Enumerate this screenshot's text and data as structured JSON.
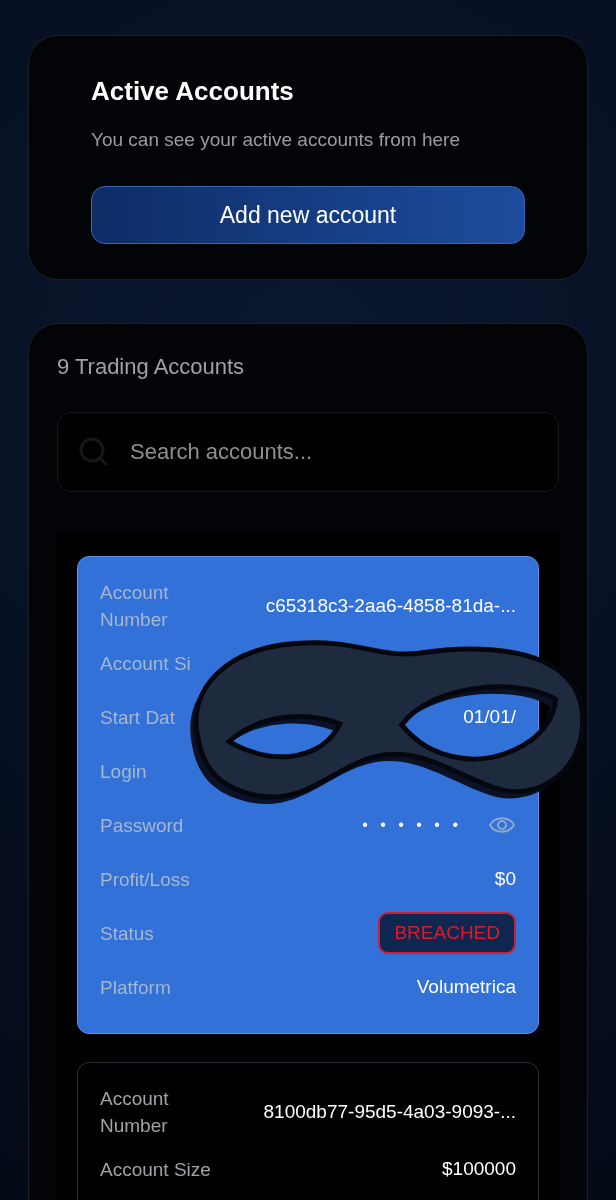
{
  "active_panel": {
    "title": "Active Accounts",
    "subtitle": "You can see your active accounts from here",
    "button": "Add new account"
  },
  "accounts_panel": {
    "count_label": "9 Trading Accounts",
    "search": {
      "placeholder": "Search accounts..."
    },
    "accounts": [
      {
        "selected": true,
        "masked": true,
        "rows": [
          {
            "kind": "text",
            "label": "Account Number",
            "value": "c65318c3-2aa6-4858-81da-..."
          },
          {
            "kind": "text",
            "label": "Account Si"
          },
          {
            "kind": "text",
            "label": "Start Dat",
            "value": "01/01/"
          },
          {
            "kind": "text",
            "label": "Login"
          },
          {
            "kind": "password",
            "label": "Password",
            "value": "• • • • • •"
          },
          {
            "kind": "text",
            "label": "Profit/Loss",
            "value": "$0"
          },
          {
            "kind": "status",
            "label": "Status",
            "value": "BREACHED"
          },
          {
            "kind": "text",
            "label": "Platform",
            "value": "Volumetrica"
          }
        ]
      },
      {
        "selected": false,
        "masked": false,
        "rows": [
          {
            "kind": "text",
            "label": "Account Number",
            "value": "8100db77-95d5-4a03-9093-..."
          },
          {
            "kind": "text",
            "label": "Account Size",
            "value": "$100000"
          }
        ]
      }
    ]
  }
}
